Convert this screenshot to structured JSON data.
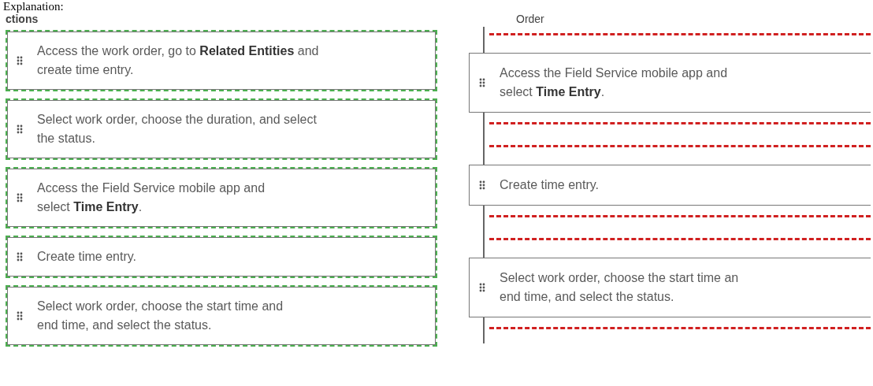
{
  "explanation": {
    "label": "Explanation:"
  },
  "actions": {
    "heading": "ctions",
    "items": [
      {
        "lines": [
          "Access the work order, go to **Related Entities** and",
          "create time entry."
        ]
      },
      {
        "lines": [
          "Select work order, choose the duration, and select",
          "the status."
        ]
      },
      {
        "lines": [
          "Access the Field Service mobile app and",
          "select **Time Entry**."
        ]
      },
      {
        "lines": [
          "Create time entry."
        ]
      },
      {
        "lines": [
          "Select work order, choose the start time and",
          "end time, and select the status."
        ]
      }
    ]
  },
  "order": {
    "heading": "Order",
    "entries": [
      {
        "kind": "slot"
      },
      {
        "kind": "item",
        "lines": [
          "Access the Field Service mobile app and",
          "select **Time Entry**."
        ]
      },
      {
        "kind": "slot"
      },
      {
        "kind": "slot"
      },
      {
        "kind": "item",
        "lines": [
          "Create time entry."
        ]
      },
      {
        "kind": "slot"
      },
      {
        "kind": "slot"
      },
      {
        "kind": "item",
        "lines": [
          "Select work order, choose the start time an",
          "end time, and select the status."
        ]
      },
      {
        "kind": "slot"
      }
    ]
  }
}
